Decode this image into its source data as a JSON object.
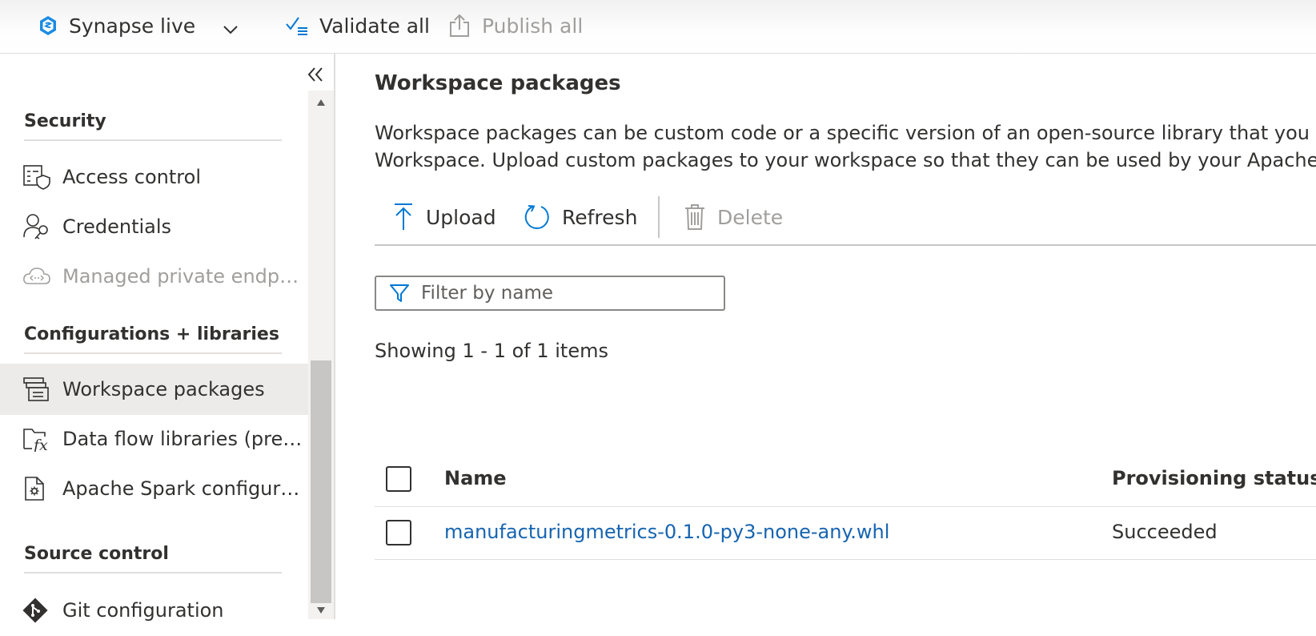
{
  "topbar": {
    "workspace_label": "Synapse live",
    "validate_label": "Validate all",
    "publish_label": "Publish all",
    "icons": [
      "synapse-icon",
      "chevron-down-icon",
      "validate-icon",
      "publish-icon"
    ]
  },
  "sidebar": {
    "sections": [
      {
        "title": "Security",
        "items": [
          {
            "label": "Access control",
            "icon": "access-control-icon",
            "disabled": false,
            "active": false
          },
          {
            "label": "Credentials",
            "icon": "credentials-icon",
            "disabled": false,
            "active": false
          },
          {
            "label": "Managed private endpoints",
            "icon": "cloud-endpoint-icon",
            "disabled": true,
            "active": false
          }
        ]
      },
      {
        "title": "Configurations + libraries",
        "items": [
          {
            "label": "Workspace packages",
            "icon": "packages-icon",
            "disabled": false,
            "active": true
          },
          {
            "label": "Data flow libraries (preview)",
            "icon": "function-folder-icon",
            "disabled": false,
            "active": false
          },
          {
            "label": "Apache Spark configurations",
            "icon": "spark-config-icon",
            "disabled": false,
            "active": false
          }
        ]
      },
      {
        "title": "Source control",
        "items": [
          {
            "label": "Git configuration",
            "icon": "git-icon",
            "disabled": false,
            "active": false
          }
        ]
      }
    ]
  },
  "main": {
    "title": "Workspace packages",
    "description_line1": "Workspace packages can be custom code or a specific version of an open-source library that you would",
    "description_line2": "Workspace. Upload custom packages to your workspace so that they can be used by your Apache Spar",
    "commands": {
      "upload": "Upload",
      "refresh": "Refresh",
      "delete": "Delete"
    },
    "filter_placeholder": "Filter by name",
    "showing_text": "Showing 1 - 1 of 1 items",
    "table": {
      "columns": [
        "Name",
        "Provisioning status"
      ],
      "rows": [
        {
          "name": "manufacturingmetrics-0.1.0-py3-none-any.whl",
          "status": "Succeeded"
        }
      ]
    }
  },
  "colors": {
    "accent": "#0078d4",
    "link": "#1664b0",
    "text": "#323130",
    "disabled": "#a19f9d",
    "selected_bg": "#edebe9"
  }
}
